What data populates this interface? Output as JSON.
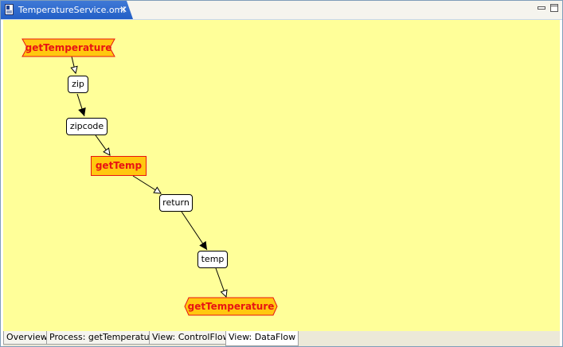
{
  "editor": {
    "tab_title": "TemperatureService.oml",
    "close_symbol": "✕",
    "minimize_icon": "minimize-icon",
    "maximize_icon": "maximize-icon"
  },
  "diagram": {
    "background": "#ffff99",
    "start_operation": "getTemperature",
    "nodes": {
      "zip": "zip",
      "zipcode": "zipcode",
      "getTemp": "getTemp",
      "return": "return",
      "temp": "temp"
    },
    "end_operation": "getTemperature",
    "operation_fill": "#ffc80f",
    "operation_text_color": "#e81313"
  },
  "bottom_tabs": [
    {
      "label": "Overview"
    },
    {
      "label": "Process: getTemperature"
    },
    {
      "label": "View: ControlFlow"
    },
    {
      "label": "View: DataFlow",
      "selected": true
    }
  ]
}
